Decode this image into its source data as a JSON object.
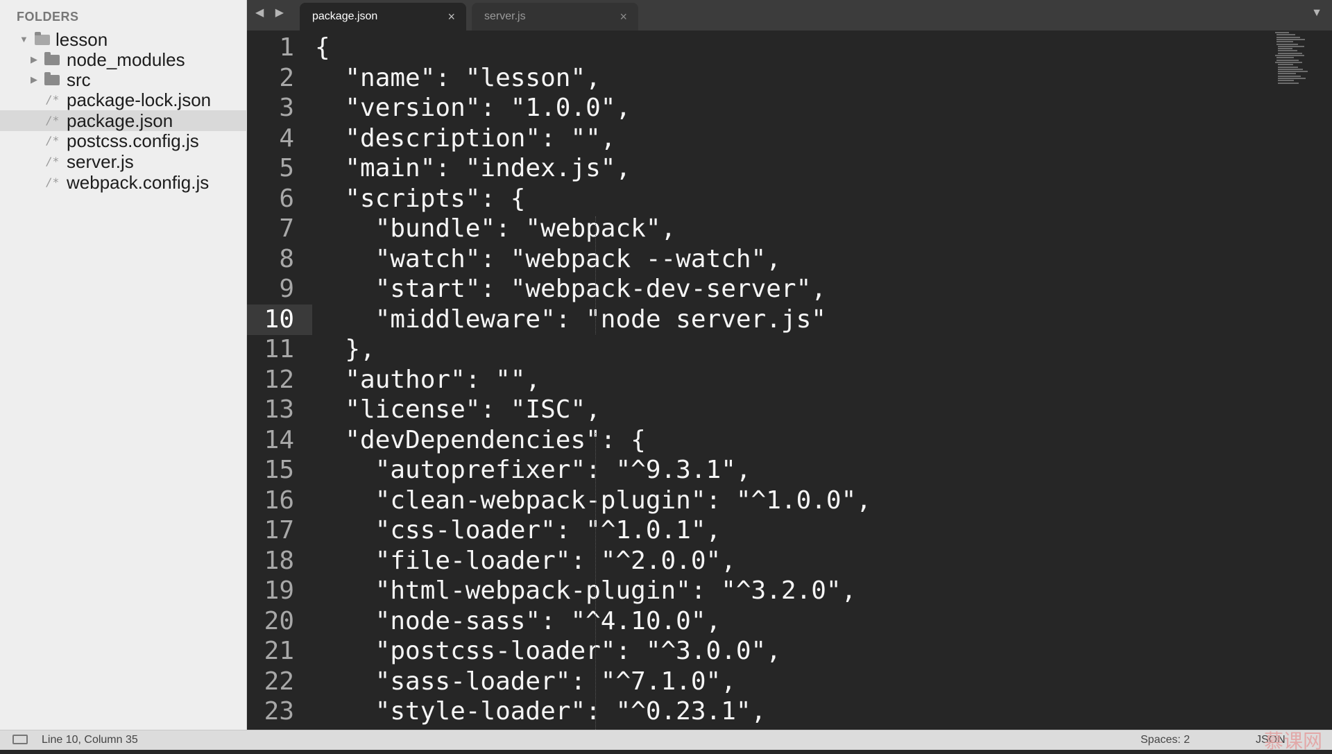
{
  "sidebar": {
    "heading": "FOLDERS",
    "root": "lesson",
    "folders": [
      "node_modules",
      "src"
    ],
    "files": [
      "package-lock.json",
      "package.json",
      "postcss.config.js",
      "server.js",
      "webpack.config.js"
    ],
    "selected_file": "package.json",
    "file_icon": "/*"
  },
  "tabs": [
    {
      "label": "package.json",
      "active": true,
      "close": "×"
    },
    {
      "label": "server.js",
      "active": false,
      "close": "×"
    }
  ],
  "nav_arrows": "◀ ▶",
  "tab_menu": "▼",
  "editor": {
    "current_line": 10,
    "lines": [
      "{",
      "  \"name\": \"lesson\",",
      "  \"version\": \"1.0.0\",",
      "  \"description\": \"\",",
      "  \"main\": \"index.js\",",
      "  \"scripts\": {",
      "    \"bundle\": \"webpack\",",
      "    \"watch\": \"webpack --watch\",",
      "    \"start\": \"webpack-dev-server\",",
      "    \"middleware\": \"node server.js\"",
      "  },",
      "  \"author\": \"\",",
      "  \"license\": \"ISC\",",
      "  \"devDependencies\": {",
      "    \"autoprefixer\": \"^9.3.1\",",
      "    \"clean-webpack-plugin\": \"^1.0.0\",",
      "    \"css-loader\": \"^1.0.1\",",
      "    \"file-loader\": \"^2.0.0\",",
      "    \"html-webpack-plugin\": \"^3.2.0\",",
      "    \"node-sass\": \"^4.10.0\",",
      "    \"postcss-loader\": \"^3.0.0\",",
      "    \"sass-loader\": \"^7.1.0\",",
      "    \"style-loader\": \"^0.23.1\","
    ]
  },
  "status": {
    "position": "Line 10, Column 35",
    "spaces": "Spaces: 2",
    "syntax": "JSON",
    "watermark": "慕课网"
  }
}
